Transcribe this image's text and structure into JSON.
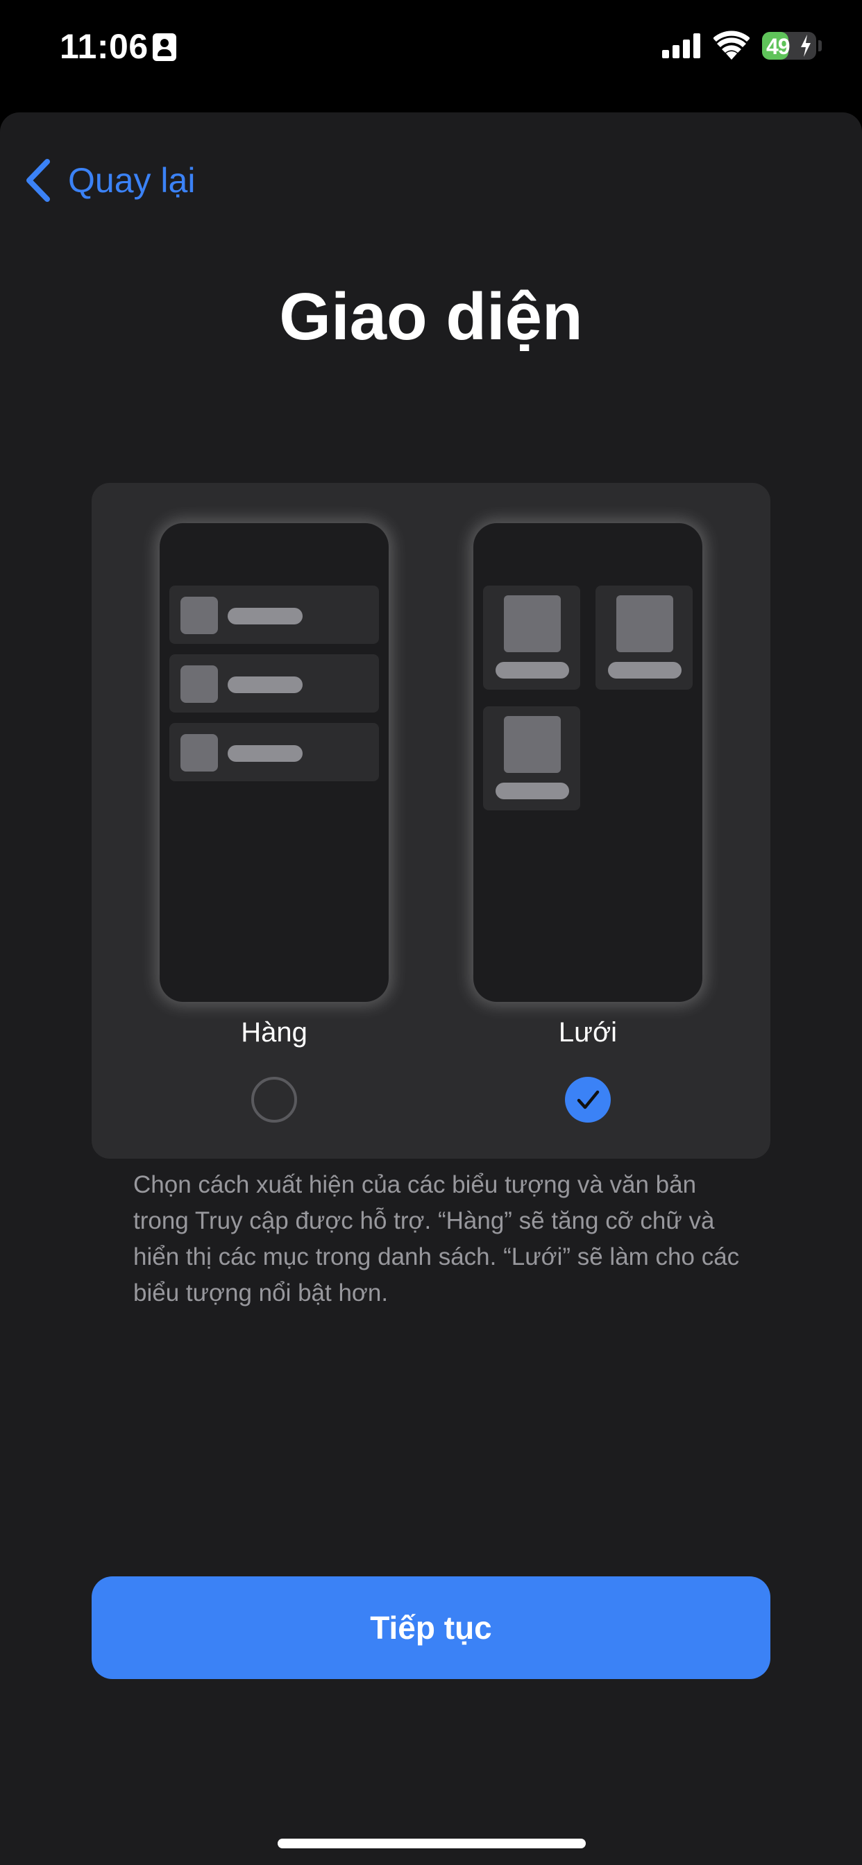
{
  "status_bar": {
    "time": "11:06",
    "battery_percent": "49",
    "battery_level": 0.49,
    "battery_color": "#5fc35a",
    "icons": [
      "contact-card-icon",
      "signal-icon",
      "wifi-icon",
      "battery-icon",
      "charging-bolt-icon"
    ]
  },
  "nav": {
    "back_label": "Quay lại",
    "back_icon": "chevron-left-icon"
  },
  "page": {
    "title": "Giao diện"
  },
  "options": {
    "row_label": "Hàng",
    "grid_label": "Lưới",
    "selected": "grid",
    "check_icon": "checkmark-icon"
  },
  "description": "Chọn cách xuất hiện của các biểu tượng và văn bản trong Truy cập được hỗ trợ. “Hàng” sẽ tăng cỡ chữ và hiển thị các mục trong danh sách. “Lưới” sẽ làm cho các biểu tượng nổi bật hơn.",
  "footer": {
    "continue_label": "Tiếp tục"
  },
  "colors": {
    "accent": "#3b82f6",
    "background": "#1c1c1e",
    "card": "#2c2c2e"
  }
}
